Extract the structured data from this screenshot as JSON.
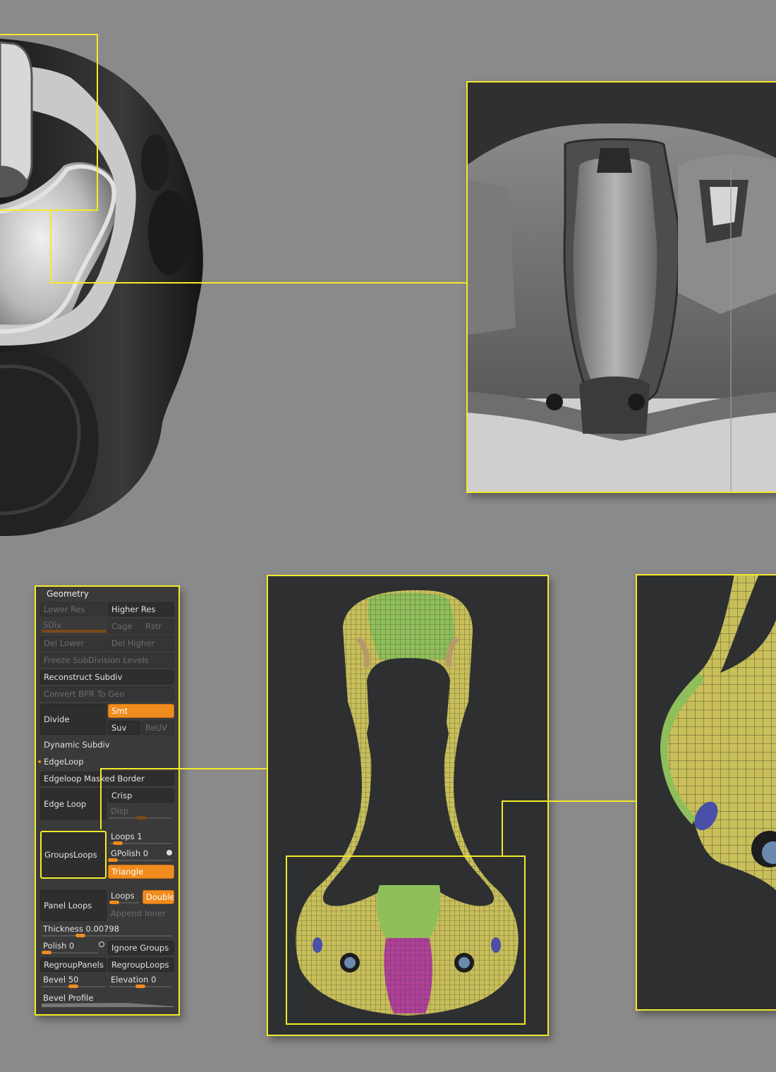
{
  "panel": {
    "title": "Geometry",
    "lower_res": "Lower Res",
    "higher_res": "Higher Res",
    "sdiv": "SDiv",
    "cage": "Cage",
    "rstr": "Rstr",
    "del_lower": "Del Lower",
    "del_higher": "Del Higher",
    "freeze": "Freeze SubDivision Levels",
    "reconstruct": "Reconstruct Subdiv",
    "convert_bpr": "Convert BPR To Geo",
    "divide": "Divide",
    "smt": "Smt",
    "suv": "Suv",
    "reuv": "ReUV",
    "dynamic_subdiv": "Dynamic Subdiv",
    "edgeloop": "EdgeLoop",
    "edgeloop_masked_border": "Edgeloop Masked Border",
    "edge_loop": "Edge Loop",
    "crisp": "Crisp",
    "disp": "Disp",
    "groups_loops": "GroupsLoops",
    "loops_label": "Loops",
    "loops_value": "1",
    "gpolish_label": "GPolish",
    "gpolish_value": "0",
    "triangle": "Triangle",
    "panel_loops": "Panel Loops",
    "loops2": "Loops",
    "double": "Double",
    "append": "Append",
    "inner": "Inner",
    "thickness_label": "Thickness",
    "thickness_value": "0.00798",
    "polish_label": "Polish",
    "polish_value": "0",
    "ignore_groups": "Ignore Groups",
    "regroup_panels": "RegroupPanels",
    "regroup_loops": "RegroupLoops",
    "bevel_label": "Bevel",
    "bevel_value": "50",
    "elevation_label": "Elevation",
    "elevation_value": "0",
    "bevel_profile": "Bevel Profile"
  },
  "colors": {
    "accent_yellow": "#f2ea2a",
    "button_orange": "#f08b1e",
    "background": "#8a8a8a",
    "viewport": "#2d2f31",
    "mesh_yellow": "#c9bf5a",
    "mesh_green": "#8fbf5a",
    "mesh_magenta": "#b0409a",
    "mesh_blue": "#4a4fa8"
  }
}
